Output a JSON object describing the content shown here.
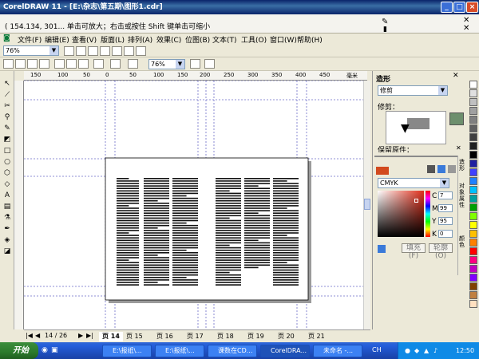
{
  "window": {
    "title": "CorelDRAW 11 - [E:\\杂志\\第五期\\图形1.cdr]",
    "status_text": "( 154.134, 301... 单击可放大；右击或按住 Shift 键单击可缩小"
  },
  "menu": [
    "文件(F)",
    "编辑(E)",
    "查看(V)",
    "版面(L)",
    "排列(A)",
    "效果(C)",
    "位图(B)",
    "文本(T)",
    "工具(O)",
    "窗口(W)",
    "帮助(H)"
  ],
  "toolbar": {
    "zoom_combo": "76%",
    "zoom_combo2": "76%"
  },
  "ruler_h_labels": [
    "150",
    "100",
    "50",
    "0",
    "50",
    "100",
    "150",
    "200",
    "250",
    "300",
    "350",
    "400",
    "450"
  ],
  "ruler_h_unit": "毫米",
  "page_nav": {
    "counter": "14 / 26",
    "tabs": [
      "页 14",
      "页 15",
      "页 16",
      "页 17",
      "页 18",
      "页 19",
      "页 20",
      "页 21"
    ],
    "active": 0
  },
  "docker": {
    "title": "造形",
    "mode": "修剪",
    "mode_label": "修剪：",
    "truncated_label": "保留原件：",
    "color_model": "CMYK",
    "cmyk": [
      {
        "label": "C",
        "value": "7"
      },
      {
        "label": "M",
        "value": "99"
      },
      {
        "label": "Y",
        "value": "95"
      },
      {
        "label": "K",
        "value": "0"
      }
    ],
    "fill_button": "填充(F)",
    "outline_button": "轮廓(O)",
    "swatch_color": "#d24a1e",
    "side_tabs": [
      "造形",
      "对象属性",
      "颜色"
    ]
  },
  "palette_colors": [
    "#ffffff",
    "#e0e0e0",
    "#c0c0c0",
    "#a0a0a0",
    "#808080",
    "#606060",
    "#404040",
    "#202020",
    "#000000",
    "#2020a0",
    "#4040ff",
    "#2080ff",
    "#00c0ff",
    "#00a0a0",
    "#00a000",
    "#80ff00",
    "#ffff00",
    "#ffc000",
    "#ff8000",
    "#ff0000",
    "#ff0080",
    "#c000c0",
    "#8000ff",
    "#804000",
    "#c08040",
    "#ffe0c0"
  ],
  "taskbar": {
    "start": "开始",
    "tasks": [
      "E:\\报纸\\...",
      "E:\\报纸\\...",
      "课数在CD...",
      "CorelDRA...",
      "未命名 -..."
    ],
    "lang": "CH",
    "time": "12:50"
  }
}
